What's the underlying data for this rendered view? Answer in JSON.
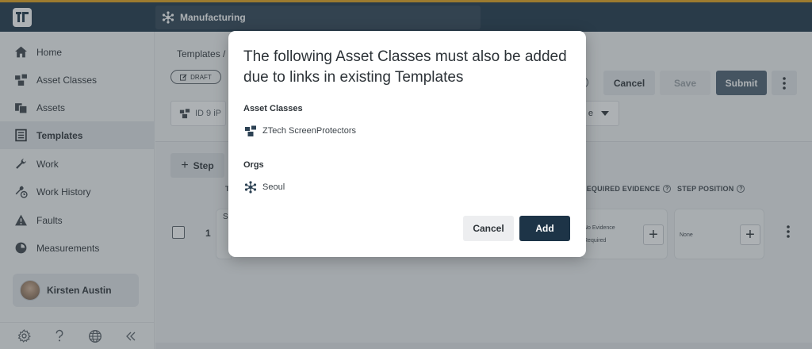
{
  "topbar": {
    "org_name": "Manufacturing"
  },
  "sidebar": {
    "items": [
      {
        "label": "Home",
        "icon": "home-icon"
      },
      {
        "label": "Asset Classes",
        "icon": "asset-classes-icon"
      },
      {
        "label": "Assets",
        "icon": "assets-icon"
      },
      {
        "label": "Templates",
        "icon": "templates-icon",
        "active": true
      },
      {
        "label": "Work",
        "icon": "wrench-icon"
      },
      {
        "label": "Work History",
        "icon": "work-history-icon"
      },
      {
        "label": "Faults",
        "icon": "warning-icon"
      },
      {
        "label": "Measurements",
        "icon": "gauge-icon"
      }
    ],
    "user_name": "Kirsten Austin",
    "footer_icons": [
      "gear-icon",
      "help-icon",
      "globe-icon",
      "collapse-icon"
    ]
  },
  "main": {
    "breadcrumb": "Templates  /",
    "status_badge": "DRAFT",
    "id_label": "ID 9  iP",
    "dropdown_value": "e",
    "buttons": {
      "cancel": "Cancel",
      "save": "Save",
      "submit": "Submit"
    },
    "add_step_label": "Step",
    "columns": {
      "title_initial": "T",
      "required_evidence": "REQUIRED EVIDENCE",
      "step_position": "STEP POSITION"
    },
    "row": {
      "number": "1",
      "title_initial": "S",
      "evidence_line1": "No Evidence",
      "evidence_line2": "Required",
      "position": "None"
    }
  },
  "dialog": {
    "title": "The following Asset Classes must also be added due to links in existing Templates",
    "asset_classes_label": "Asset Classes",
    "asset_classes": [
      "ZTech ScreenProtectors"
    ],
    "orgs_label": "Orgs",
    "orgs": [
      "Seoul"
    ],
    "cancel_label": "Cancel",
    "add_label": "Add"
  },
  "colors": {
    "navy": "#1d3447",
    "accent_bar": "#e3a21a",
    "submit": "#4c5f70"
  }
}
